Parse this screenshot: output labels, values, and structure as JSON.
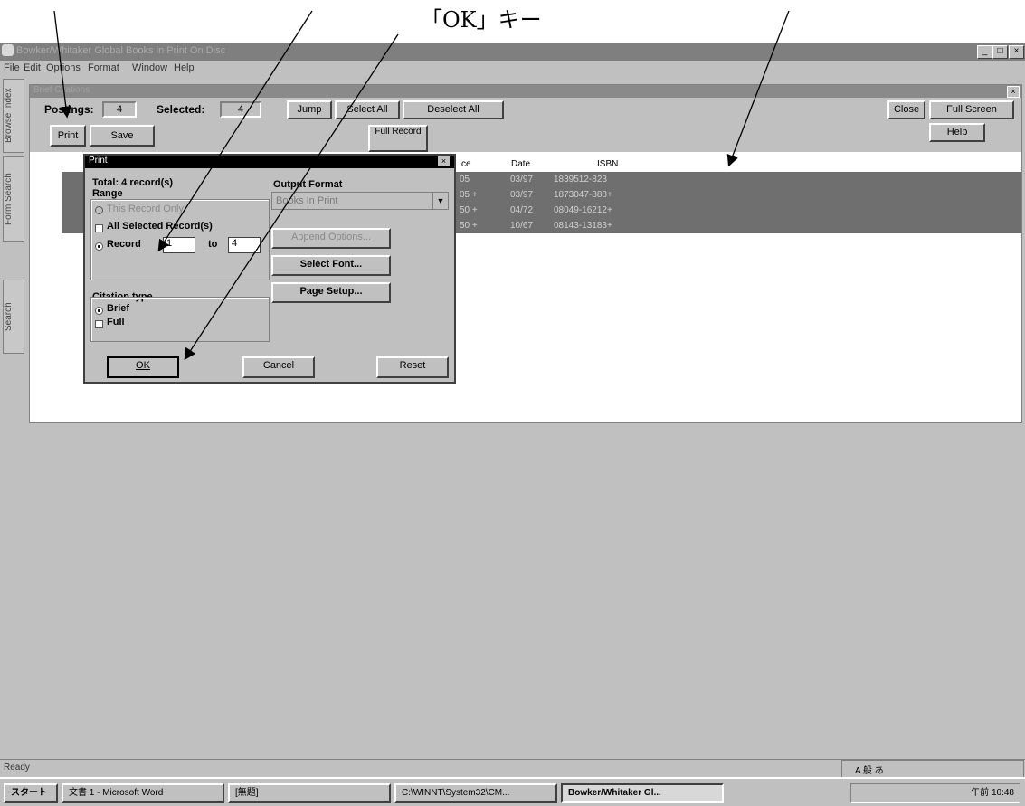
{
  "annotation": {
    "label": "「OK」キー"
  },
  "window": {
    "title": "Bowker/Whitaker Global Books in Print On Disc",
    "controls": {
      "minimize": "_",
      "maximize": "□",
      "close": "×"
    }
  },
  "menu": [
    "File",
    "Edit",
    "Options",
    "Format",
    "Window",
    "Help"
  ],
  "side_tabs": [
    "Browse Index",
    "Form Search",
    "Search"
  ],
  "child": {
    "title": "Brief Citations",
    "postings_label": "Postings:",
    "postings_value": "4",
    "selected_label": "Selected:",
    "selected_value": "4",
    "buttons": {
      "jump": "Jump",
      "select_all": "Select All",
      "deselect_all": "Deselect All",
      "close": "Close",
      "full_screen": "Full Screen",
      "print": "Print",
      "save": "Save",
      "full_record": "Full Record",
      "help": "Help"
    },
    "columns": {
      "price": "ce",
      "date": "Date",
      "isbn": "ISBN"
    },
    "rows": [
      {
        "price": "05",
        "date": "03/97",
        "isbn": "1839512-823"
      },
      {
        "price": "05 +",
        "date": "03/97",
        "isbn": "1873047-888+"
      },
      {
        "price": "50 +",
        "date": "04/72",
        "isbn": "08049-16212+"
      },
      {
        "price": "50 +",
        "date": "10/67",
        "isbn": "08143-13183+"
      }
    ]
  },
  "dialog": {
    "title": "Print",
    "total": "Total: 4 record(s)",
    "range_label": "Range",
    "range_options": [
      "This Record Only",
      "All Selected Record(s)",
      "Record"
    ],
    "record_from": "1",
    "record_to_label": "to",
    "record_to": "4",
    "output_format_label": "Output Format",
    "output_format_value": "Books In Print",
    "buttons": {
      "append": "Append Options...",
      "select_font": "Select Font...",
      "page_setup": "Page Setup...",
      "ok": "OK",
      "cancel": "Cancel",
      "reset": "Reset"
    },
    "citation_label": "Citation type",
    "citation_options": [
      "Brief",
      "Full"
    ]
  },
  "status": {
    "text": "Ready"
  },
  "taskbar": {
    "start": "スタート",
    "tasks": [
      "文書 1 - Microsoft Word",
      "[無題]",
      "C:\\WINNT\\System32\\CM...",
      "Bowker/Whitaker Gl..."
    ],
    "clock": "午前 10:48"
  },
  "ime": {
    "text": "A 般 あ"
  }
}
